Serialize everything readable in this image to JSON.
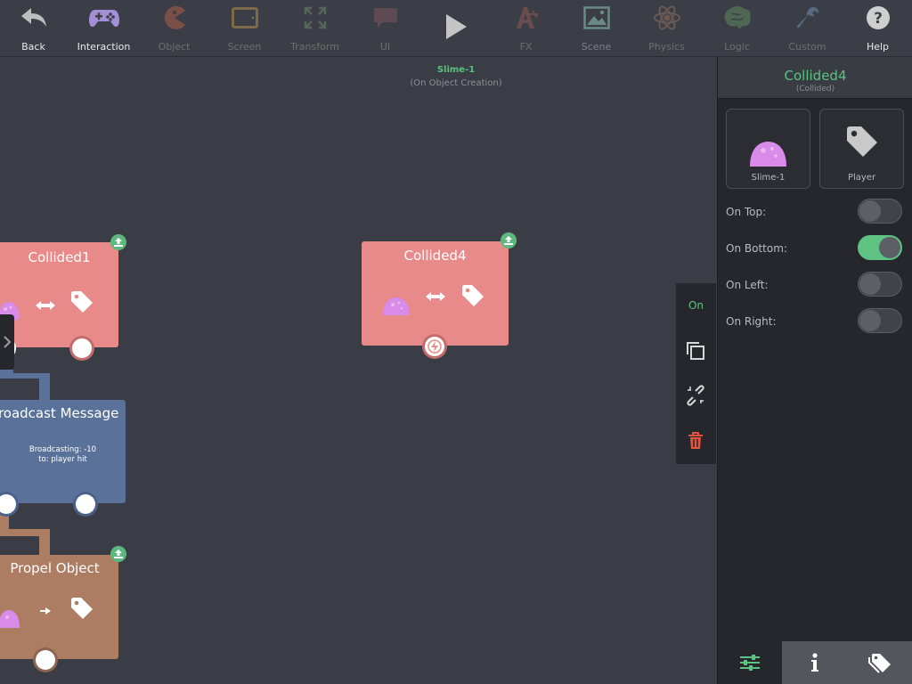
{
  "toolbar": {
    "items": [
      {
        "label": "Back",
        "icon": "back-arrow-icon"
      },
      {
        "label": "Interaction",
        "icon": "gamepad-icon"
      },
      {
        "label": "Object",
        "icon": "pacman-icon"
      },
      {
        "label": "Screen",
        "icon": "tablet-icon"
      },
      {
        "label": "Transform",
        "icon": "expand-arrows-icon"
      },
      {
        "label": "UI",
        "icon": "speech-bubble-icon"
      },
      {
        "label": "",
        "icon": "play-icon"
      },
      {
        "label": "FX",
        "icon": "fx-icon"
      },
      {
        "label": "Scene",
        "icon": "landscape-image-icon"
      },
      {
        "label": "Physics",
        "icon": "atom-icon"
      },
      {
        "label": "Logic",
        "icon": "brain-icon"
      },
      {
        "label": "Custom",
        "icon": "wrench-icon"
      },
      {
        "label": "Help",
        "icon": "help-icon"
      }
    ]
  },
  "canvas": {
    "scene_title": "Slime-1",
    "scene_subtitle": "(On Object Creation)",
    "nodes": {
      "collided1": {
        "title": "Collided1"
      },
      "collided4": {
        "title": "Collided4"
      },
      "broadcast": {
        "title": "Broadcast Message",
        "line1": "Broadcasting: -10",
        "line2": "to: player hit"
      },
      "propel": {
        "title": "Propel Object"
      }
    }
  },
  "floatbar": {
    "on_label": "On",
    "icons": [
      "duplicate-icon",
      "unlink-icon",
      "trash-icon"
    ]
  },
  "panel": {
    "title": "Collided4",
    "subtitle": "(Collided)",
    "cards": [
      {
        "label": "Slime-1",
        "icon": "slime-icon"
      },
      {
        "label": "Player",
        "icon": "tag-icon"
      }
    ],
    "toggles": [
      {
        "label": "On Top:",
        "on": false
      },
      {
        "label": "On Bottom:",
        "on": true
      },
      {
        "label": "On Left:",
        "on": false
      },
      {
        "label": "On Right:",
        "on": false
      }
    ],
    "tabs": [
      "sliders-icon",
      "info-icon",
      "tags-icon"
    ]
  },
  "colors": {
    "accent_green": "#5dc282",
    "collide_node": "#e88a8a",
    "broadcast_node": "#5a7299",
    "propel_node": "#ad7d63",
    "slime": "#d88be8",
    "trash": "#e4533f"
  }
}
